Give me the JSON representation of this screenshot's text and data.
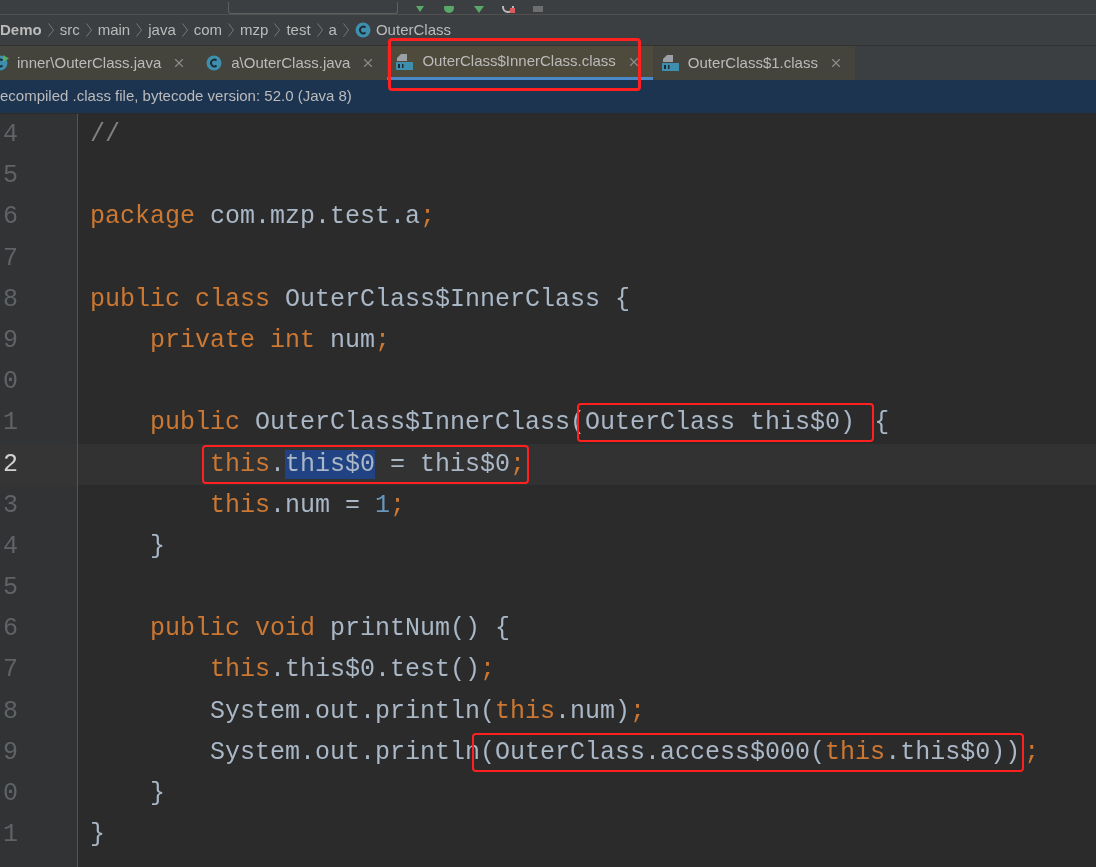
{
  "breadcrumbs": [
    {
      "text": "Demo",
      "kind": "project"
    },
    {
      "text": "src",
      "kind": "folder"
    },
    {
      "text": "main",
      "kind": "folder"
    },
    {
      "text": "java",
      "kind": "folder"
    },
    {
      "text": "com",
      "kind": "folder"
    },
    {
      "text": "mzp",
      "kind": "folder"
    },
    {
      "text": "test",
      "kind": "folder"
    },
    {
      "text": "a",
      "kind": "folder"
    },
    {
      "text": "OuterClass",
      "kind": "class"
    }
  ],
  "tabs": [
    {
      "label": "inner\\OuterClass.java",
      "kind": "runnable-class",
      "selected": false,
      "marked": false
    },
    {
      "label": "a\\OuterClass.java",
      "kind": "class",
      "selected": false,
      "marked": false
    },
    {
      "label": "OuterClass$InnerClass.class",
      "kind": "binary",
      "selected": true,
      "marked": true
    },
    {
      "label": "OuterClass$1.class",
      "kind": "binary",
      "selected": false,
      "marked": false
    }
  ],
  "banner": "ecompiled .class file, bytecode version: 52.0 (Java 8)",
  "lines": [
    {
      "number": "4",
      "current": false,
      "tokens": [
        {
          "kind": "comment",
          "text": "//"
        }
      ]
    },
    {
      "number": "5",
      "current": false
    },
    {
      "number": "6",
      "current": false,
      "tokens": [
        {
          "kind": "keyword",
          "text": "package"
        },
        {
          "kind": "plain",
          "text": " com.mzp.test.a"
        },
        {
          "kind": "keyword",
          "text": ";"
        }
      ]
    },
    {
      "number": "7",
      "current": false
    },
    {
      "number": "8",
      "current": false,
      "tokens": [
        {
          "kind": "keyword",
          "text": "public class"
        },
        {
          "kind": "plain",
          "text": " OuterClass$InnerClass {"
        }
      ],
      "children": [
        {
          "number": "9",
          "current": false,
          "tokens": [
            {
              "kind": "keyword",
              "text": "private int"
            },
            {
              "kind": "plain",
              "text": " num"
            },
            {
              "kind": "keyword",
              "text": ";"
            }
          ]
        },
        {
          "number": "0",
          "current": false
        },
        {
          "number": "1",
          "current": false,
          "tokens": [
            {
              "kind": "keyword",
              "text": "public"
            },
            {
              "kind": "plain",
              "text": " OuterClass$InnerClass("
            },
            {
              "kind": "box",
              "tokens": [
                {
                  "kind": "plain",
                  "text": "OuterClass this$0) "
                }
              ]
            },
            {
              "kind": "plain",
              "text": "{"
            }
          ],
          "children": [
            {
              "number": "2",
              "current": true,
              "tokens": [
                {
                  "kind": "box",
                  "tokens": [
                    {
                      "kind": "keyword",
                      "text": "this"
                    },
                    {
                      "kind": "plain",
                      "text": "."
                    },
                    {
                      "kind": "plain",
                      "text": "this$0",
                      "highlighted": true
                    },
                    {
                      "kind": "plain",
                      "text": " = this$0"
                    },
                    {
                      "kind": "keyword",
                      "text": ";"
                    }
                  ]
                }
              ]
            },
            {
              "number": "3",
              "current": false,
              "tokens": [
                {
                  "kind": "keyword",
                  "text": "this"
                },
                {
                  "kind": "plain",
                  "text": ".num = "
                },
                {
                  "kind": "number",
                  "text": "1"
                },
                {
                  "kind": "keyword",
                  "text": ";"
                }
              ]
            }
          ]
        },
        {
          "number": "4",
          "current": false,
          "tokens": [
            {
              "kind": "plain",
              "text": "}"
            }
          ]
        },
        {
          "number": "5",
          "current": false
        },
        {
          "number": "6",
          "current": false,
          "tokens": [
            {
              "kind": "keyword",
              "text": "public void"
            },
            {
              "kind": "plain",
              "text": " printNum() {"
            }
          ],
          "children": [
            {
              "number": "7",
              "current": false,
              "tokens": [
                {
                  "kind": "keyword",
                  "text": "this"
                },
                {
                  "kind": "plain",
                  "text": ".this$0.test()"
                },
                {
                  "kind": "keyword",
                  "text": ";"
                }
              ]
            },
            {
              "number": "8",
              "current": false,
              "tokens": [
                {
                  "kind": "plain",
                  "text": "System.out.println("
                },
                {
                  "kind": "keyword",
                  "text": "this"
                },
                {
                  "kind": "plain",
                  "text": ".num)"
                },
                {
                  "kind": "keyword",
                  "text": ";"
                }
              ]
            },
            {
              "number": "9",
              "current": false,
              "tokens": [
                {
                  "kind": "plain",
                  "text": "System.out.println"
                },
                {
                  "kind": "box",
                  "tokens": [
                    {
                      "kind": "plain",
                      "text": "(OuterClass.access$000("
                    },
                    {
                      "kind": "keyword",
                      "text": "this"
                    },
                    {
                      "kind": "plain",
                      "text": ".this$0))"
                    }
                  ]
                },
                {
                  "kind": "keyword",
                  "text": ";"
                }
              ]
            }
          ]
        },
        {
          "number": "0",
          "current": false,
          "tokens": [
            {
              "kind": "plain",
              "text": "}"
            }
          ]
        }
      ]
    },
    {
      "number": "1",
      "current": false,
      "tokens": [
        {
          "kind": "plain",
          "text": "}"
        }
      ]
    }
  ]
}
